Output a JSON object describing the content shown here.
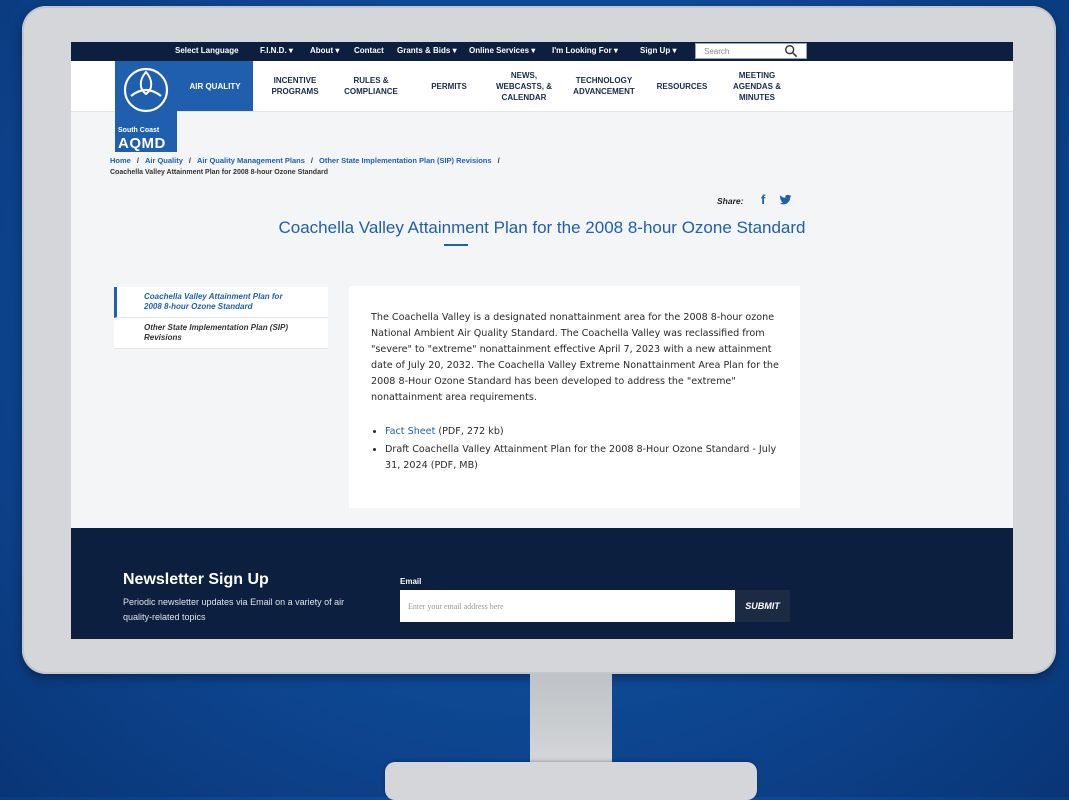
{
  "topbar": {
    "select_language": "Select Language",
    "find": "F.I.N.D. ▾",
    "about": "About ▾",
    "contact": "Contact",
    "grants": "Grants & Bids ▾",
    "online_services": "Online Services ▾",
    "looking_for": "I'm Looking For ▾",
    "sign_up": "Sign Up ▾",
    "search_placeholder": "Search"
  },
  "logo": {
    "line1": "South Coast",
    "line2": "AQMD"
  },
  "nav": {
    "air_quality": "AIR QUALITY",
    "incentive": "INCENTIVE\nPROGRAMS",
    "rules": "RULES &\nCOMPLIANCE",
    "permits": "PERMITS",
    "news": "NEWS,\nWEBCASTS, &\nCALENDAR",
    "technology": "TECHNOLOGY\nADVANCEMENT",
    "resources": "RESOURCES",
    "meeting": "MEETING\nAGENDAS &\nMINUTES"
  },
  "breadcrumb": {
    "items": [
      "Home",
      "Air Quality",
      "Air Quality Management Plans",
      "Other State Implementation Plan (SIP) Revisions"
    ],
    "current": "Coachella Valley Attainment Plan for 2008 8-hour Ozone Standard"
  },
  "share": {
    "label": "Share:",
    "facebook": "f"
  },
  "page_title": "Coachella Valley Attainment Plan for the 2008 8-hour Ozone Standard",
  "side_menu": [
    {
      "label": "Coachella Valley Attainment Plan for 2008 8-hour Ozone Standard"
    },
    {
      "label": "Other State Implementation Plan (SIP) Revisions"
    }
  ],
  "content": {
    "paragraph": "The Coachella Valley is a designated nonattainment area for the 2008 8-hour ozone National Ambient Air Quality Standard. The Coachella Valley was reclassified from \"severe\" to \"extreme\" nonattainment effective April 7, 2023 with a new attainment date of July 20, 2032. The Coachella Valley Extreme Nonattainment Area Plan for the 2008 8-Hour Ozone Standard has been developed to address the \"extreme\" nonattainment area requirements.",
    "link1_text": "Fact Sheet",
    "link1_suffix": " (PDF, 272 kb)",
    "item2": "Draft Coachella Valley Attainment Plan for the 2008 8-Hour Ozone Standard - July 31, 2024 (PDF, MB)"
  },
  "footer": {
    "title": "Newsletter Sign Up",
    "description": "Periodic newsletter updates via Email on a variety of air quality-related topics",
    "email_label": "Email",
    "email_placeholder": "Enter your email address here",
    "submit": "SUBMIT"
  }
}
